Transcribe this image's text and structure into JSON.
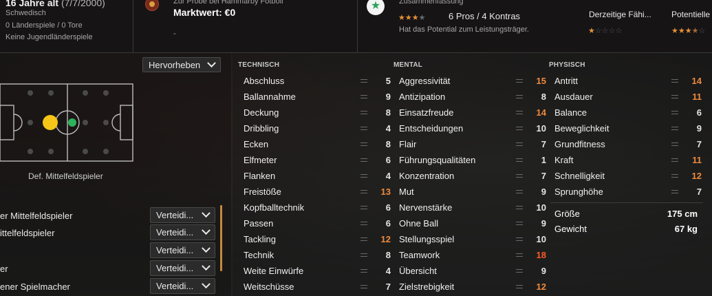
{
  "header": {
    "age_text": "16 Jahre alt",
    "birth_date": "(7/7/2000)",
    "nationality": "Schwedisch",
    "caps": "0 Länderspiele / 0 Tore",
    "youth_caps": "Keine Jugendländerspiele",
    "club_status": "Zur Probe bei Hammarby Fotboll",
    "market_value": "Marktwert: €0",
    "dash": "-",
    "summary_title": "Zusammenfassung",
    "pros_cons": "6 Pros / 4 Kontras",
    "potential_text": "Hat das Potential zum Leistungsträger.",
    "current_ability_label": "Derzeitige Fähi...",
    "potential_label": "Potentielle",
    "summary_stars": 3.5,
    "current_ability_stars": 1,
    "potential_stars": 3.5,
    "star_color": "#e8913a"
  },
  "highlight_button": "Hervorheben",
  "pitch": {
    "position_label": "Def. Mittelfeldspieler",
    "main_dot_color": "#f5c518",
    "secondary_dot_color": "#2db35c"
  },
  "roles": [
    {
      "label": "er Mittelfeldspieler",
      "duty": "Verteidi..."
    },
    {
      "label": "ittelfeldspieler",
      "duty": "Verteidi..."
    },
    {
      "label": "",
      "duty": "Verteidi..."
    },
    {
      "label": "er",
      "duty": "Verteidi..."
    },
    {
      "label": "ener Spielmacher",
      "duty": "Verteidi..."
    }
  ],
  "columns": {
    "technical": "TECHNISCH",
    "mental": "MENTAL",
    "physical": "PHYSISCH"
  },
  "technical": [
    {
      "name": "Abschluss",
      "value": "5"
    },
    {
      "name": "Ballannahme",
      "value": "9"
    },
    {
      "name": "Deckung",
      "value": "8"
    },
    {
      "name": "Dribbling",
      "value": "4"
    },
    {
      "name": "Ecken",
      "value": "8"
    },
    {
      "name": "Elfmeter",
      "value": "6"
    },
    {
      "name": "Flanken",
      "value": "4"
    },
    {
      "name": "Freistöße",
      "value": "13"
    },
    {
      "name": "Kopfballtechnik",
      "value": "6"
    },
    {
      "name": "Passen",
      "value": "6"
    },
    {
      "name": "Tackling",
      "value": "12"
    },
    {
      "name": "Technik",
      "value": "8"
    },
    {
      "name": "Weite Einwürfe",
      "value": "4"
    },
    {
      "name": "Weitschüsse",
      "value": "7"
    }
  ],
  "mental": [
    {
      "name": "Aggressivität",
      "value": "15"
    },
    {
      "name": "Antizipation",
      "value": "8"
    },
    {
      "name": "Einsatzfreude",
      "value": "14"
    },
    {
      "name": "Entscheidungen",
      "value": "10"
    },
    {
      "name": "Flair",
      "value": "7"
    },
    {
      "name": "Führungsqualitäten",
      "value": "1"
    },
    {
      "name": "Konzentration",
      "value": "7"
    },
    {
      "name": "Mut",
      "value": "9"
    },
    {
      "name": "Nervenstärke",
      "value": "10"
    },
    {
      "name": "Ohne Ball",
      "value": "9"
    },
    {
      "name": "Stellungsspiel",
      "value": "10"
    },
    {
      "name": "Teamwork",
      "value": "18"
    },
    {
      "name": "Übersicht",
      "value": "9"
    },
    {
      "name": "Zielstrebigkeit",
      "value": "12"
    }
  ],
  "physical": [
    {
      "name": "Antritt",
      "value": "14"
    },
    {
      "name": "Ausdauer",
      "value": "11"
    },
    {
      "name": "Balance",
      "value": "6"
    },
    {
      "name": "Beweglichkeit",
      "value": "9"
    },
    {
      "name": "Grundfitness",
      "value": "7"
    },
    {
      "name": "Kraft",
      "value": "11"
    },
    {
      "name": "Schnelligkeit",
      "value": "12"
    },
    {
      "name": "Sprunghöhe",
      "value": "7"
    }
  ],
  "body": {
    "height_label": "Größe",
    "height_value": "175 cm",
    "weight_label": "Gewicht",
    "weight_value": "67 kg"
  },
  "colors": {
    "value_high": "#f08a3c",
    "value_top": "#ff5a2a",
    "value_normal": "#e6e6e6"
  }
}
